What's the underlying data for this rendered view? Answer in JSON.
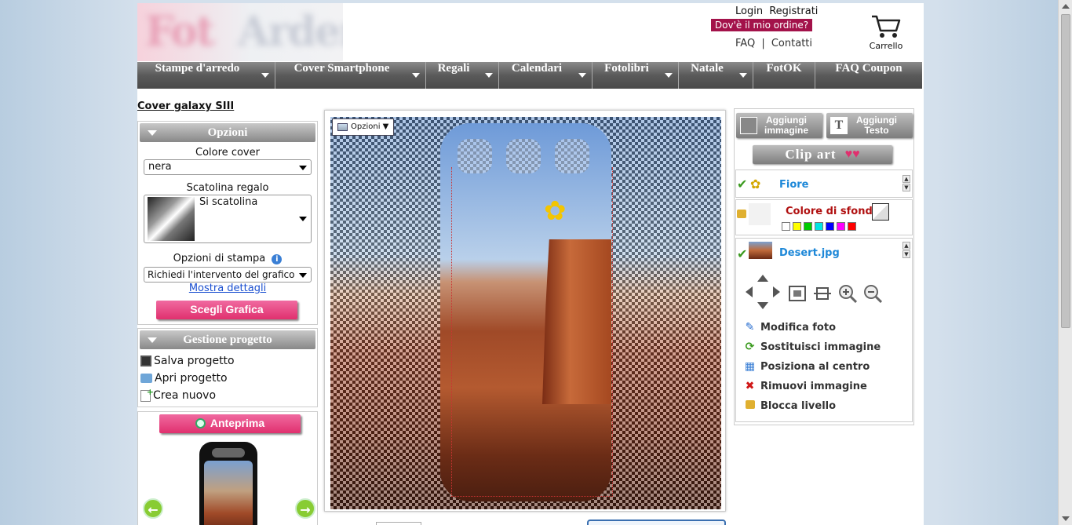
{
  "header": {
    "login": "Login",
    "register": "Registrati",
    "order_button": "Dov'è il mio ordine?",
    "faq": "FAQ",
    "separator": "|",
    "contacts": "Contatti",
    "cart": "Carrello"
  },
  "nav": [
    {
      "label": "Stampe d'arredo",
      "dropdown": true
    },
    {
      "label": "Cover Smartphone",
      "dropdown": true
    },
    {
      "label": "Regali",
      "dropdown": true
    },
    {
      "label": "Calendari",
      "dropdown": true
    },
    {
      "label": "Fotolibri",
      "dropdown": true
    },
    {
      "label": "Natale",
      "dropdown": true
    },
    {
      "label": "FotOK",
      "dropdown": false
    },
    {
      "label": "FAQ Coupon",
      "dropdown": false
    }
  ],
  "page_title": "Cover galaxy SIII",
  "options_panel": {
    "title": "Opzioni",
    "cover_color_label": "Colore cover",
    "cover_color_value": "nera",
    "gift_box_label": "Scatolina regalo",
    "gift_box_value": "Si scatolina",
    "print_options_label": "Opzioni di stampa",
    "print_options_value": "Richiedi l'intervento del grafico",
    "details_link": "Mostra dettagli",
    "choose_graphic_button": "Scegli Grafica"
  },
  "project_panel": {
    "title": "Gestione progetto",
    "save": "Salva progetto",
    "open": "Apri progetto",
    "create": "Crea nuovo"
  },
  "preview": {
    "button": "Anteprima"
  },
  "canvas": {
    "options_button": "Opzioni ▼"
  },
  "right_panel": {
    "add_image": "Aggiungi immagine",
    "add_text": "Aggiungi Testo",
    "clip_art": "Clip art",
    "layers": [
      {
        "name": "Fiore"
      },
      {
        "name": "Colore di sfondo"
      },
      {
        "name": "Desert.jpg"
      }
    ],
    "colors": [
      "#ffffff",
      "#ffff00",
      "#00cc00",
      "#00e5e5",
      "#0000ff",
      "#ff00ff",
      "#ff0000"
    ],
    "actions": [
      {
        "icon": "pencil-icon",
        "label": "Modifica foto"
      },
      {
        "icon": "refresh-icon",
        "label": "Sostituisci immagine"
      },
      {
        "icon": "grid-center-icon",
        "label": "Posiziona al centro"
      },
      {
        "icon": "red-x-icon",
        "label": "Rimuovi immagine"
      },
      {
        "icon": "lock-icon",
        "label": "Blocca livello"
      }
    ]
  },
  "colors": {
    "nav_bg": "#5a5a5a",
    "pink": "#e0306e",
    "order_bg": "#a3124a",
    "layer_name": "#1e88d8"
  }
}
